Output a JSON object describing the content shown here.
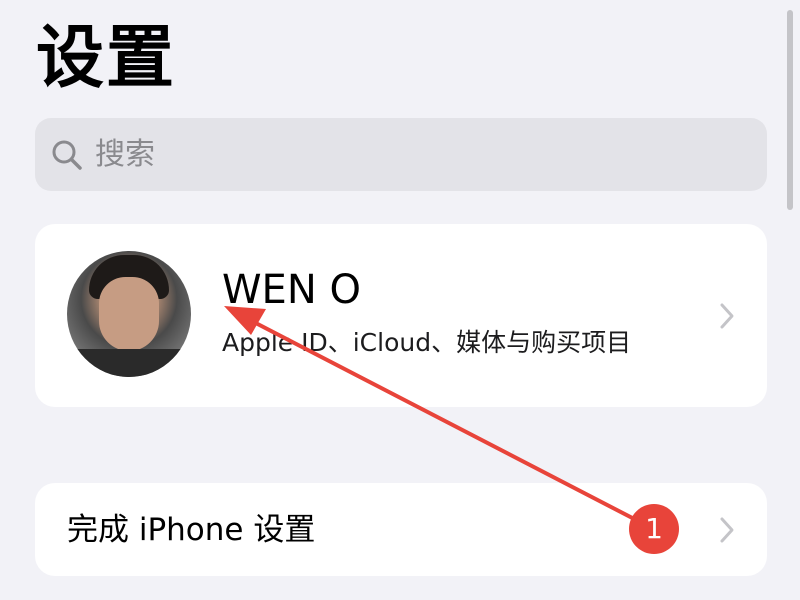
{
  "header": {
    "title": "设置"
  },
  "search": {
    "placeholder": "搜索",
    "icon": "search-icon"
  },
  "profile": {
    "name": "WEN O",
    "subtitle": "Apple ID、iCloud、媒体与购买项目",
    "avatar": "person-photo"
  },
  "setup_row": {
    "label": "完成 iPhone 设置",
    "badge_count": "1"
  },
  "colors": {
    "background": "#f2f2f7",
    "card": "#ffffff",
    "search_field": "#e3e3e8",
    "placeholder": "#8a8a8e",
    "badge": "#e8443a",
    "annotation_arrow": "#e8443a",
    "chevron": "#c4c4c8"
  }
}
